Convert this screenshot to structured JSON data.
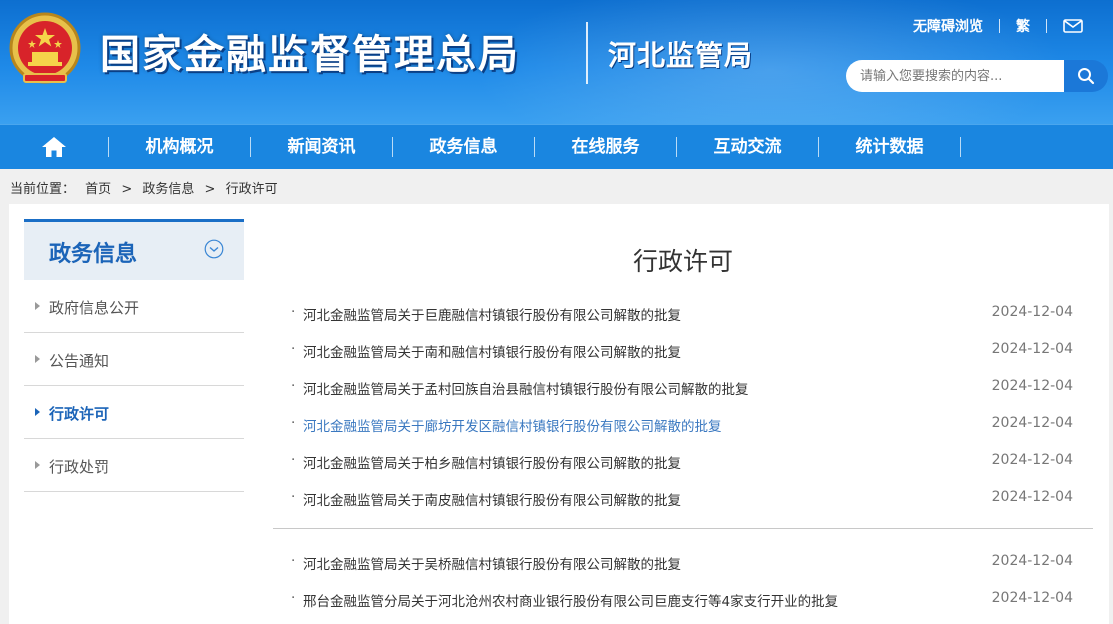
{
  "header": {
    "site_title": "国家金融监督管理总局",
    "sub_title": "河北监管局",
    "top_links": [
      "无障碍浏览",
      "繁"
    ],
    "search_placeholder": "请输入您要搜索的内容..."
  },
  "nav": {
    "items": [
      "机构概况",
      "新闻资讯",
      "政务信息",
      "在线服务",
      "互动交流",
      "统计数据"
    ]
  },
  "breadcrumb": {
    "label": "当前位置：",
    "items": [
      "首页",
      ">",
      "政务信息",
      ">",
      "行政许可"
    ]
  },
  "sidebar": {
    "title": "政务信息",
    "items": [
      {
        "label": "政府信息公开",
        "active": false
      },
      {
        "label": "公告通知",
        "active": false
      },
      {
        "label": "行政许可",
        "active": true
      },
      {
        "label": "行政处罚",
        "active": false
      }
    ]
  },
  "main": {
    "title": "行政许可",
    "bullet": "·",
    "rows": [
      {
        "title": "河北金融监管局关于巨鹿融信村镇银行股份有限公司解散的批复",
        "date": "2024-12-04"
      },
      {
        "title": "河北金融监管局关于南和融信村镇银行股份有限公司解散的批复",
        "date": "2024-12-04"
      },
      {
        "title": "河北金融监管局关于孟村回族自治县融信村镇银行股份有限公司解散的批复",
        "date": "2024-12-04"
      },
      {
        "title": "河北金融监管局关于廊坊开发区融信村镇银行股份有限公司解散的批复",
        "date": "2024-12-04"
      },
      {
        "title": "河北金融监管局关于柏乡融信村镇银行股份有限公司解散的批复",
        "date": "2024-12-04"
      },
      {
        "title": "河北金融监管局关于南皮融信村镇银行股份有限公司解散的批复",
        "date": "2024-12-04"
      },
      {
        "title": "河北金融监管局关于吴桥融信村镇银行股份有限公司解散的批复",
        "date": "2024-12-04"
      },
      {
        "title": "邢台金融监管分局关于河北沧州农村商业银行股份有限公司巨鹿支行等4家支行开业的批复",
        "date": "2024-12-04"
      }
    ]
  },
  "colors": {
    "header_blue": "#1f8ae8",
    "nav_blue": "#1a86e0",
    "active_blue": "#1b64b8",
    "link_hover": "#3a78c0"
  }
}
